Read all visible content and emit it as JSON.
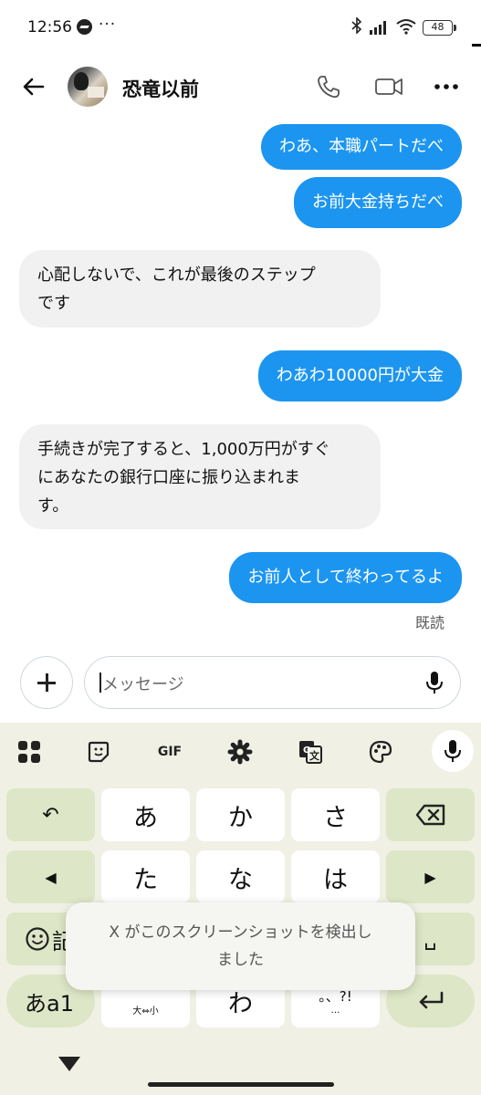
{
  "status_bar": {
    "time": "12:56",
    "more": "···",
    "battery": "48"
  },
  "header": {
    "title": "恐竜以前",
    "back_icon": "arrow-left-icon",
    "call_icon": "phone-icon",
    "video_icon": "video-camera-icon",
    "more_icon": "more-horizontal-icon"
  },
  "messages": [
    {
      "side": "outgoing",
      "text": "わあ、本職パートだべ"
    },
    {
      "side": "outgoing",
      "text": "お前大金持ちだべ"
    },
    {
      "side": "incoming",
      "text": "心配しないで、これが最後のステップ\nです"
    },
    {
      "side": "outgoing",
      "text": "わあわ10000円が大金"
    },
    {
      "side": "incoming",
      "text": "手続きが完了すると、1,000万円がすぐ\nにあなたの銀行口座に振り込まれま\nす。"
    },
    {
      "side": "outgoing",
      "text": "お前人として終わってるよ"
    }
  ],
  "read_receipt": "既読",
  "composer": {
    "placeholder": "メッセージ",
    "value": ""
  },
  "keyboard": {
    "toolbar": {
      "gif_label": "GIF"
    },
    "keys": {
      "a": "あ",
      "ka": "か",
      "sa": "さ",
      "ta": "た",
      "na": "な",
      "ha": "は",
      "wa": "わ",
      "left_label": "◀",
      "right_label": "▶",
      "undo_label": "↶",
      "space_label": "␣",
      "enter_label": "↵",
      "mode_label": "あa1",
      "emoji_partial": "記",
      "dakuten_sub": "大⇔小",
      "punct_label": "。、?!",
      "punct_sub": "…"
    }
  },
  "toast": {
    "text": "X がこのスクリーンショットを検出し\nました"
  },
  "colors": {
    "outgoing_bubble": "#1c95f0",
    "incoming_bubble": "#f1f1f1",
    "keyboard_bg": "#f0f1e4",
    "function_key": "#dde6c6"
  }
}
